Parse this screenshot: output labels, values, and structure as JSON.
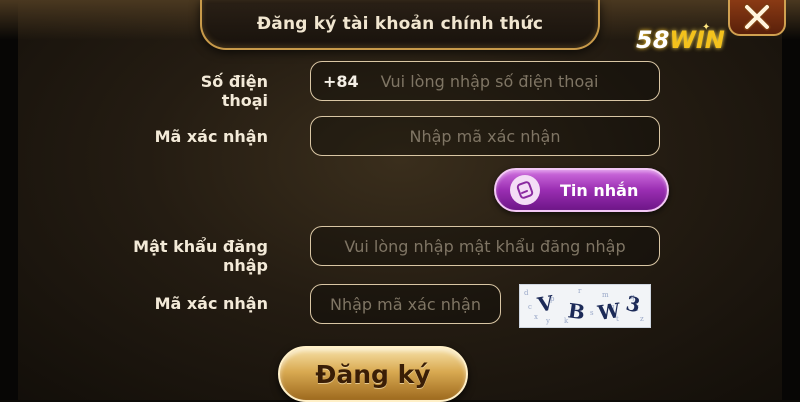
{
  "dialog": {
    "title": "Đăng ký tài khoản chính thức",
    "close_icon": "close-icon"
  },
  "logo": {
    "number": "58",
    "word": "WIN"
  },
  "form": {
    "phone": {
      "label": "Số điện thoại",
      "prefix": "+84",
      "placeholder": "Vui lòng nhập số điện thoại"
    },
    "sms_code": {
      "label": "Mã xác nhận",
      "placeholder": "Nhập mã xác nhận"
    },
    "sms_button": {
      "label": "Tin nhắn",
      "icon": "phone-message-icon"
    },
    "password": {
      "label": "Mật khẩu đăng nhập",
      "placeholder": "Vui lòng nhập mật khẩu đăng nhập"
    },
    "captcha": {
      "label": "Mã xác nhận",
      "placeholder": "Nhập mã xác nhận",
      "image_text": "VBW3"
    },
    "submit": {
      "label": "Đăng ký"
    }
  },
  "colors": {
    "accent_gold": "#c89a4a",
    "sms_purple": "#9a2eb2",
    "logo_yellow": "#f4c21c"
  }
}
